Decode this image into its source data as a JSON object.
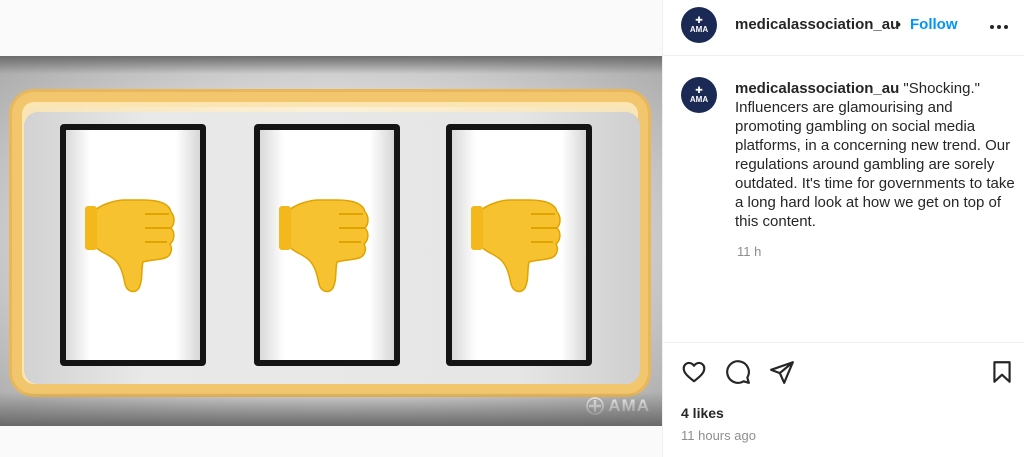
{
  "account": {
    "username": "medicalassociation_au",
    "avatar_text": "AMA",
    "separator": "•",
    "follow_label": "Follow"
  },
  "media": {
    "watermark_text": "AMA",
    "reels": [
      {
        "symbol": "thumbs-down-emoji"
      },
      {
        "symbol": "thumbs-down-emoji"
      },
      {
        "symbol": "thumbs-down-emoji"
      }
    ]
  },
  "caption": {
    "username": "medicalassociation_au",
    "text": "\"Shocking.\" Influencers are glamourising and promoting gambling on social media platforms, in a concerning new trend. Our regulations around gambling are sorely outdated. It's time for governments to take a long hard look at how we get on top of this content.",
    "time": "11 h"
  },
  "actions": {
    "icons": [
      "heart-icon",
      "comment-icon",
      "share-icon",
      "bookmark-icon"
    ]
  },
  "stats": {
    "likes": "4 likes",
    "posted": "11 hours ago"
  },
  "colors": {
    "link_blue": "#0095f6",
    "avatar_navy": "#1b2a55",
    "frame_gold": "#f2c66c",
    "emoji_yellow": "#f6c22f"
  }
}
